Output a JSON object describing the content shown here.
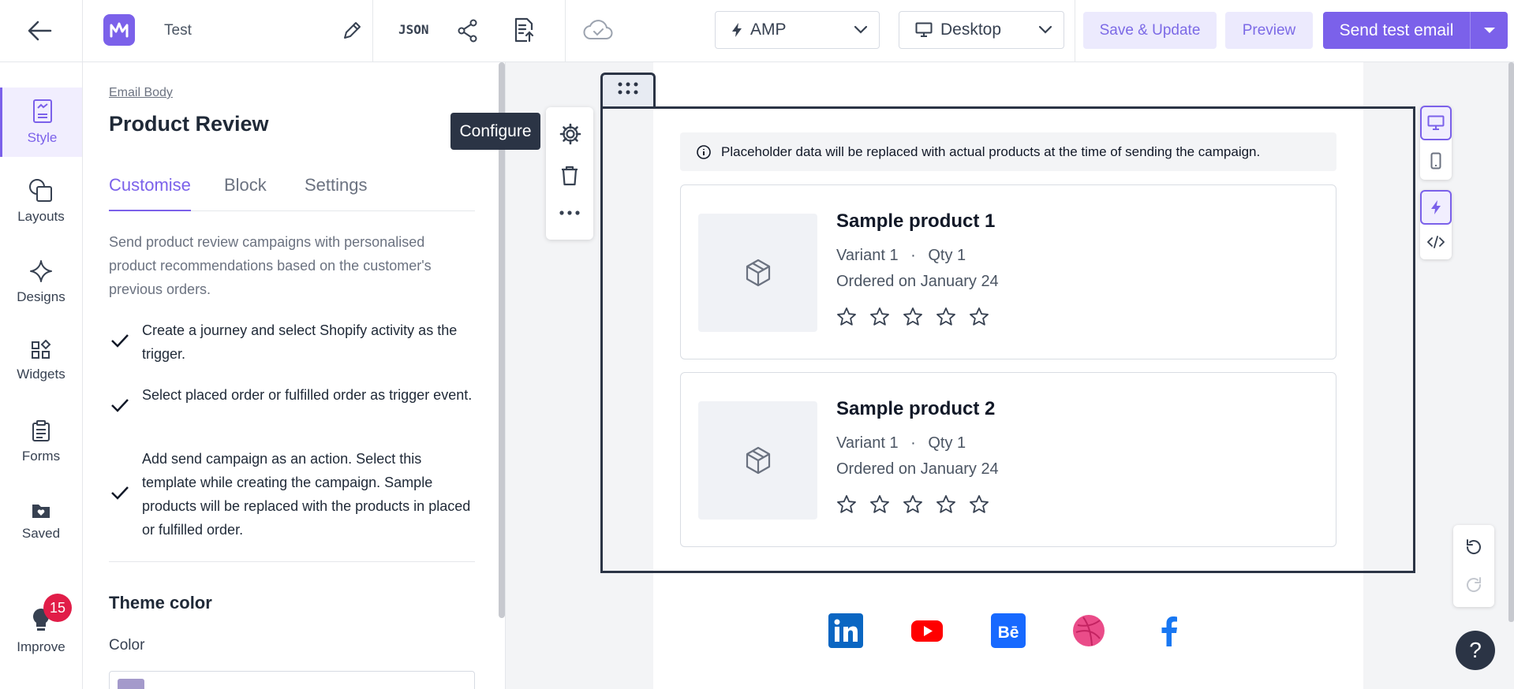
{
  "header": {
    "title": "Test",
    "json_label": "JSON",
    "format_select": "AMP",
    "device_select": "Desktop",
    "save_label": "Save & Update",
    "preview_label": "Preview",
    "send_label": "Send test email"
  },
  "rail": [
    {
      "label": "Style"
    },
    {
      "label": "Layouts"
    },
    {
      "label": "Designs"
    },
    {
      "label": "Widgets"
    },
    {
      "label": "Forms"
    },
    {
      "label": "Saved"
    },
    {
      "label": "Improve",
      "badge": "15"
    }
  ],
  "panel": {
    "breadcrumb": "Email Body",
    "title": "Product Review",
    "tabs": [
      "Customise",
      "Block",
      "Settings"
    ],
    "description": "Send product review campaigns with personalised product recommendations based on the customer's previous orders.",
    "checklist": [
      "Create a journey and select Shopify activity as the trigger.",
      "Select placed order or fulfilled order as trigger event.",
      "Add send campaign as an action. Select this template while creating the campaign. Sample products will be replaced with the products in placed or fulfilled order."
    ],
    "theme_heading": "Theme color",
    "color_label": "Color"
  },
  "canvas": {
    "tooltip": "Configure",
    "notice": "Placeholder data will be replaced with actual products at the time of sending the campaign.",
    "products": [
      {
        "name": "Sample product 1",
        "variant": "Variant 1",
        "qty": "Qty 1",
        "ordered": "Ordered on January 24",
        "rating": 0,
        "max_rating": 5
      },
      {
        "name": "Sample product 2",
        "variant": "Variant 1",
        "qty": "Qty 1",
        "ordered": "Ordered on January 24",
        "rating": 0,
        "max_rating": 5
      }
    ],
    "social": [
      "linkedin-icon",
      "youtube-icon",
      "behance-icon",
      "dribbble-icon",
      "facebook-icon"
    ]
  },
  "colors": {
    "accent": "#7b61ea",
    "dark": "#2b3445",
    "badge": "#e11d48"
  }
}
